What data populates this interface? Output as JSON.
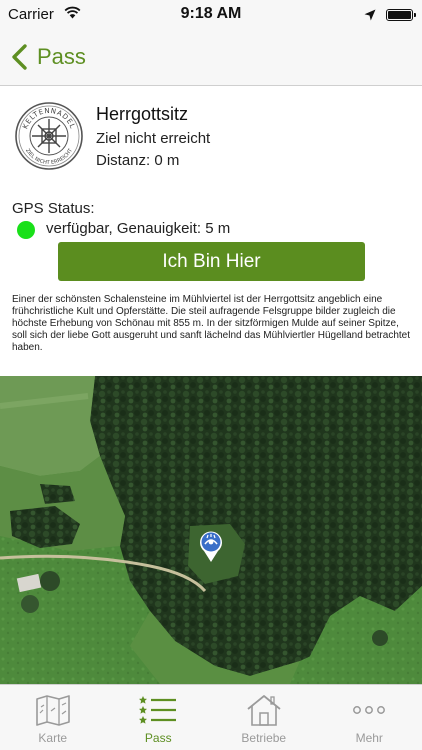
{
  "status_bar": {
    "carrier": "Carrier",
    "time": "9:18 AM",
    "icons": [
      "wifi-icon",
      "location-arrow-icon",
      "battery-icon"
    ]
  },
  "nav": {
    "back_label": "Pass",
    "accent_color": "#5e8f22"
  },
  "location": {
    "stamp_text_top": "KELTENNADEL",
    "stamp_text_bottom": "ZIEL NICHT ERREICHT",
    "title": "Herrgottsitz",
    "goal_status": "Ziel nicht erreicht",
    "distance_label": "Distanz:",
    "distance_value": "0 m"
  },
  "gps": {
    "label": "GPS Status:",
    "status_text": "verfügbar, Genauigkeit: 5 m",
    "indicator_color": "#19e019"
  },
  "action": {
    "button_label": "Ich Bin Hier",
    "button_color": "#5b8d1f"
  },
  "description": "Einer der schönsten Schalensteine im Mühlviertel ist der Herrgottsitz angeblich eine frühchristliche Kult und Opferstätte. Die steil aufragende Felsgruppe bilder zugleich die höchste Erhebung von Schönau mit 855 m. In der sitzförmigen Mulde auf seiner Spitze, soll sich der liebe Gott ausgeruht und sanft lächelnd das Mühlviertler Hügelland betrachtet haben.",
  "map": {
    "type": "satellite",
    "marker_icon": "map-pin-icon"
  },
  "tab_bar": {
    "active": "Pass",
    "tabs": [
      {
        "label": "Karte",
        "icon": "map-icon"
      },
      {
        "label": "Pass",
        "icon": "star-list-icon"
      },
      {
        "label": "Betriebe",
        "icon": "house-icon"
      },
      {
        "label": "Mehr",
        "icon": "more-dots-icon"
      }
    ]
  }
}
